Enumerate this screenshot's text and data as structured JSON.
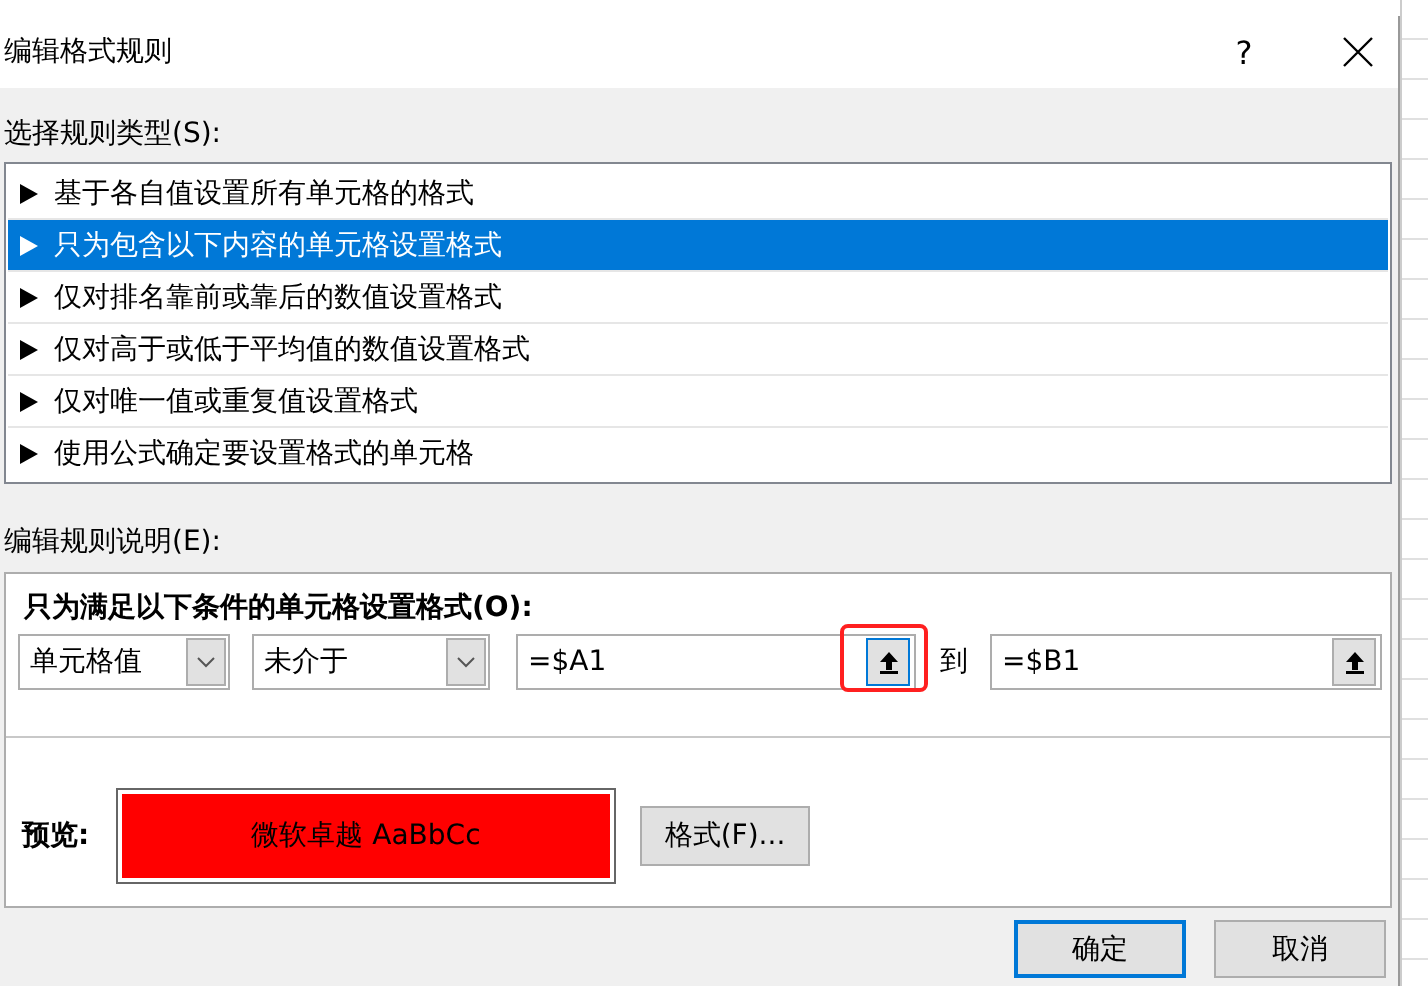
{
  "window": {
    "title": "编辑格式规则",
    "help": "?"
  },
  "rule_type": {
    "label": "选择规则类型(S):",
    "items": [
      {
        "label": "基于各自值设置所有单元格的格式",
        "selected": false
      },
      {
        "label": "只为包含以下内容的单元格设置格式",
        "selected": true
      },
      {
        "label": "仅对排名靠前或靠后的数值设置格式",
        "selected": false
      },
      {
        "label": "仅对高于或低于平均值的数值设置格式",
        "selected": false
      },
      {
        "label": "仅对唯一值或重复值设置格式",
        "selected": false
      },
      {
        "label": "使用公式确定要设置格式的单元格",
        "selected": false
      }
    ]
  },
  "description": {
    "label": "编辑规则说明(E):",
    "condition_label": "只为满足以下条件的单元格设置格式(O):",
    "condition_type": "单元格值",
    "operator": "未介于",
    "value_1": {
      "value": "=$A1",
      "highlighted": true
    },
    "between_label": "到",
    "value_2": {
      "value": "=$B1",
      "highlighted": false
    },
    "preview_label": "预览:",
    "preview_text": "微软卓越  AaBbCc",
    "format_button": "格式(F)..."
  },
  "buttons": [
    {
      "label": "确定",
      "default": true
    },
    {
      "label": "取消",
      "default": false
    }
  ]
}
